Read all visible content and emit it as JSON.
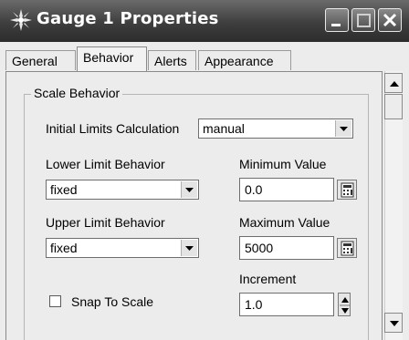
{
  "window": {
    "title": "Gauge 1 Properties"
  },
  "tabs": [
    {
      "label": "General"
    },
    {
      "label": "Behavior",
      "active": true
    },
    {
      "label": "Alerts"
    },
    {
      "label": "Appearance"
    }
  ],
  "scale_behavior": {
    "group_title": "Scale Behavior",
    "initial_limits": {
      "label": "Initial Limits Calculation",
      "value": "manual"
    },
    "lower_limit": {
      "label": "Lower Limit Behavior",
      "value": "fixed"
    },
    "minimum": {
      "label": "Minimum Value",
      "value": "0.0"
    },
    "upper_limit": {
      "label": "Upper Limit Behavior",
      "value": "fixed"
    },
    "maximum": {
      "label": "Maximum Value",
      "value": "5000"
    },
    "increment": {
      "label": "Increment",
      "value": "1.0"
    },
    "snap": {
      "label": "Snap To Scale",
      "checked": false
    }
  },
  "icons": {
    "app": "gear-icon",
    "minimize": "minimize-icon",
    "maximize": "maximize-icon",
    "close": "close-icon",
    "calculator": "calculator-icon",
    "dropdown": "chevron-down-icon"
  },
  "colors": {
    "titlebar": "#3e3e3e",
    "background": "#ececec"
  }
}
